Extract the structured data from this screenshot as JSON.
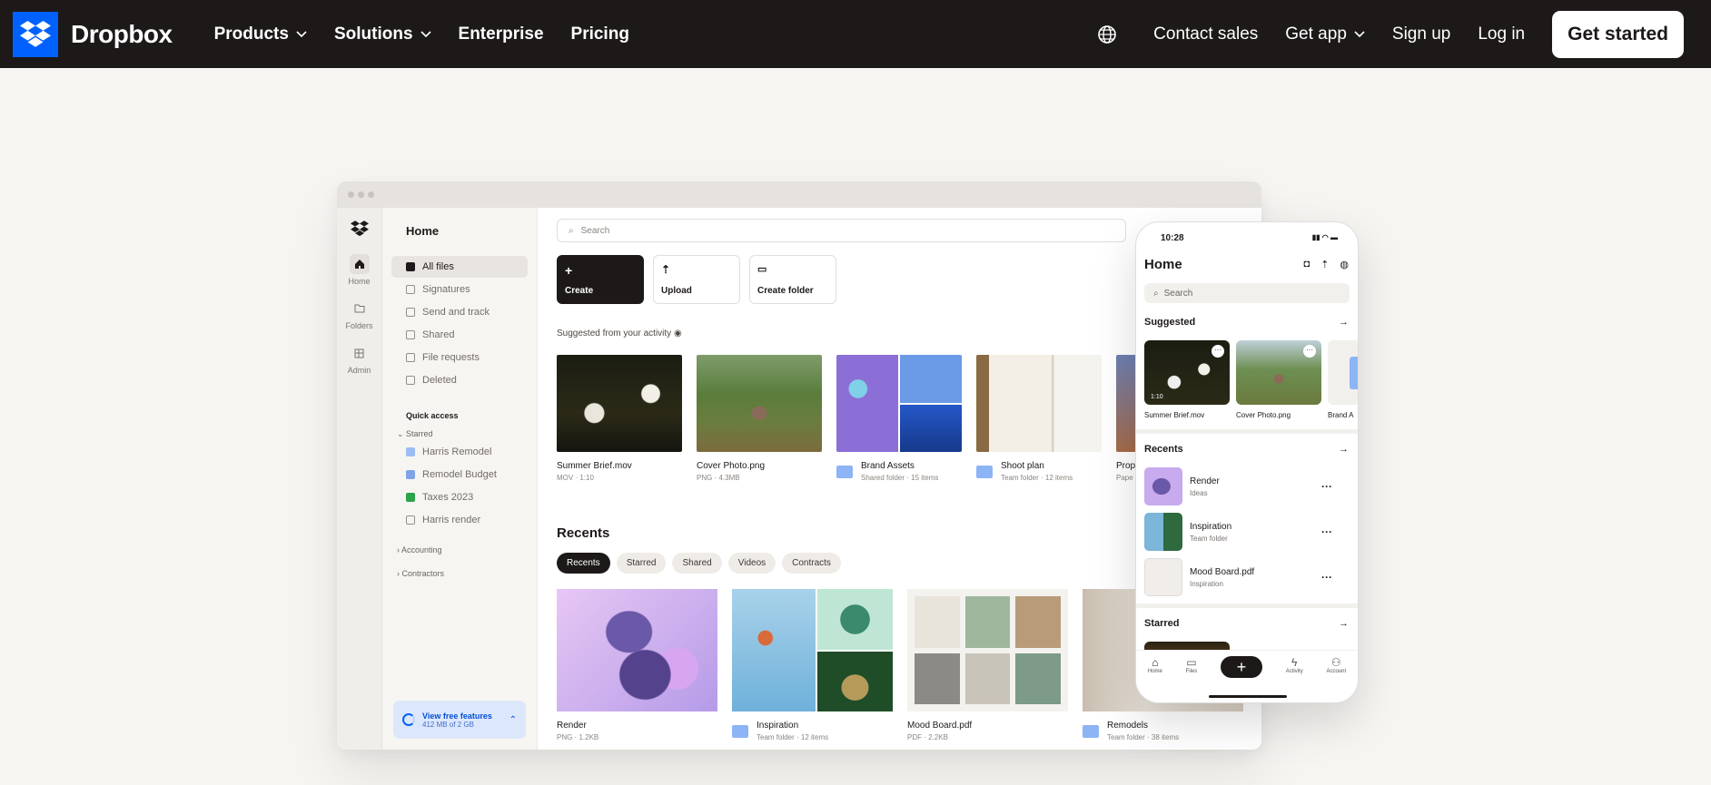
{
  "nav": {
    "brand": "Dropbox",
    "products": "Products",
    "solutions": "Solutions",
    "enterprise": "Enterprise",
    "pricing": "Pricing",
    "contact_sales": "Contact sales",
    "get_app": "Get app",
    "sign_up": "Sign up",
    "log_in": "Log in",
    "get_started": "Get started"
  },
  "desktop": {
    "rail": [
      {
        "label": "Home",
        "icon": "home-icon"
      },
      {
        "label": "Folders",
        "icon": "folder-icon"
      },
      {
        "label": "Admin",
        "icon": "admin-icon"
      }
    ],
    "sidebar": {
      "title": "Home",
      "links": [
        "All files",
        "Signatures",
        "Send and track",
        "Shared",
        "File requests",
        "Deleted"
      ],
      "quick_access": "Quick access",
      "starred": "Starred",
      "starred_items": [
        "Harris Remodel",
        "Remodel Budget",
        "Taxes 2023",
        "Harris render"
      ],
      "accounting": "Accounting",
      "contractors": "Contractors",
      "storage_title": "View free features",
      "storage_meta": "412 MB of 2 GB"
    },
    "search_placeholder": "Search",
    "actions": [
      "Create",
      "Upload",
      "Create folder"
    ],
    "suggested_heading": "Suggested from your activity",
    "suggested": [
      {
        "name": "Summer Brief.mov",
        "meta": "MOV · 1:10"
      },
      {
        "name": "Cover Photo.png",
        "meta": "PNG · 4.3MB"
      },
      {
        "name": "Brand Assets",
        "meta": "Shared folder · 15 items"
      },
      {
        "name": "Shoot plan",
        "meta": "Team folder · 12 items"
      },
      {
        "name": "Prop",
        "meta": "Pape"
      }
    ],
    "recents_heading": "Recents",
    "pills": [
      "Recents",
      "Starred",
      "Shared",
      "Videos",
      "Contracts"
    ],
    "recents": [
      {
        "name": "Render",
        "meta": "PNG · 1.2KB"
      },
      {
        "name": "Inspiration",
        "meta": "Team folder · 12 items"
      },
      {
        "name": "Mood Board.pdf",
        "meta": "PDF · 2.2KB"
      },
      {
        "name": "Remodels",
        "meta": "Team folder · 38 items"
      }
    ]
  },
  "phone": {
    "time": "10:28",
    "title": "Home",
    "search_placeholder": "Search",
    "suggested": "Suggested",
    "suggested_items": [
      {
        "name": "Summer Brief.mov",
        "badge": "1:10"
      },
      {
        "name": "Cover Photo.png"
      },
      {
        "name": "Brand A"
      }
    ],
    "recents": "Recents",
    "recent_rows": [
      {
        "name": "Render",
        "meta": "Ideas"
      },
      {
        "name": "Inspiration",
        "meta": "Team folder"
      },
      {
        "name": "Mood Board.pdf",
        "meta": "Inspiration"
      }
    ],
    "starred": "Starred",
    "tabs": [
      "Home",
      "Files",
      "Activity",
      "Account"
    ]
  },
  "colors": {
    "brand": "#0061fe",
    "nav_bg": "#1e1919",
    "page_bg": "#f7f5f2"
  }
}
